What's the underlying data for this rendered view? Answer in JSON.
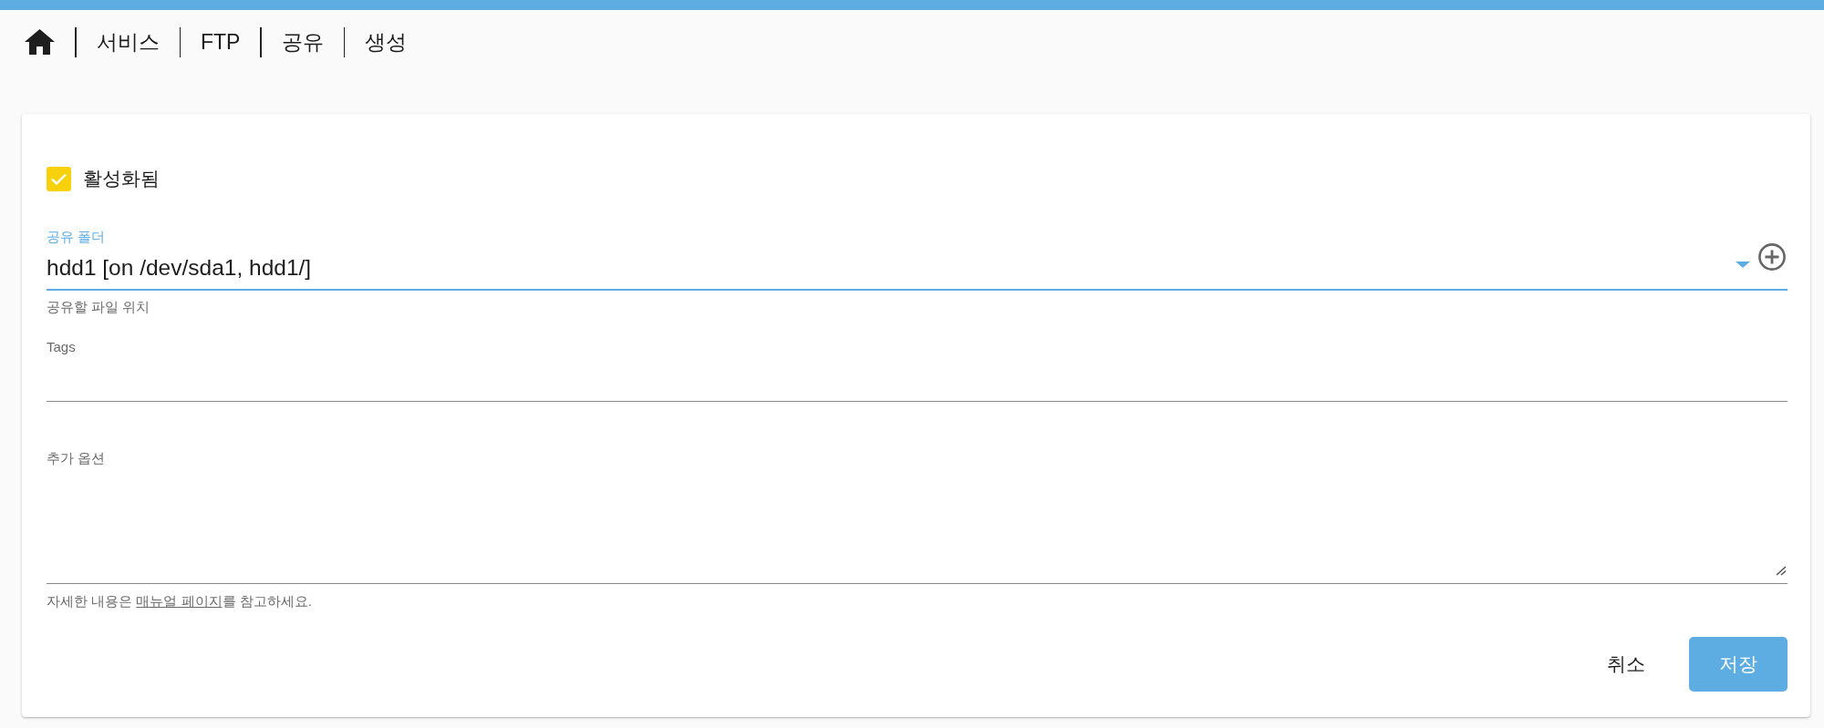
{
  "breadcrumb": [
    "서비스",
    "FTP",
    "공유",
    "생성"
  ],
  "form": {
    "enabled": {
      "label": "활성화됨",
      "checked": true
    },
    "shared_folder": {
      "label": "공유 폴더",
      "value": "hdd1 [on /dev/sda1, hdd1/]",
      "helper_text": "공유할 파일 위치",
      "focused": true
    },
    "tags": {
      "label": "Tags"
    },
    "extra_options": {
      "label": "추가 옵션"
    },
    "help": {
      "before": "자세한 내용은 ",
      "link": "매뉴얼 페이지",
      "after": "를 참고하세요."
    }
  },
  "buttons": [
    {
      "label": "취소",
      "kind": "text"
    },
    {
      "label": "저장",
      "kind": "primary"
    }
  ]
}
